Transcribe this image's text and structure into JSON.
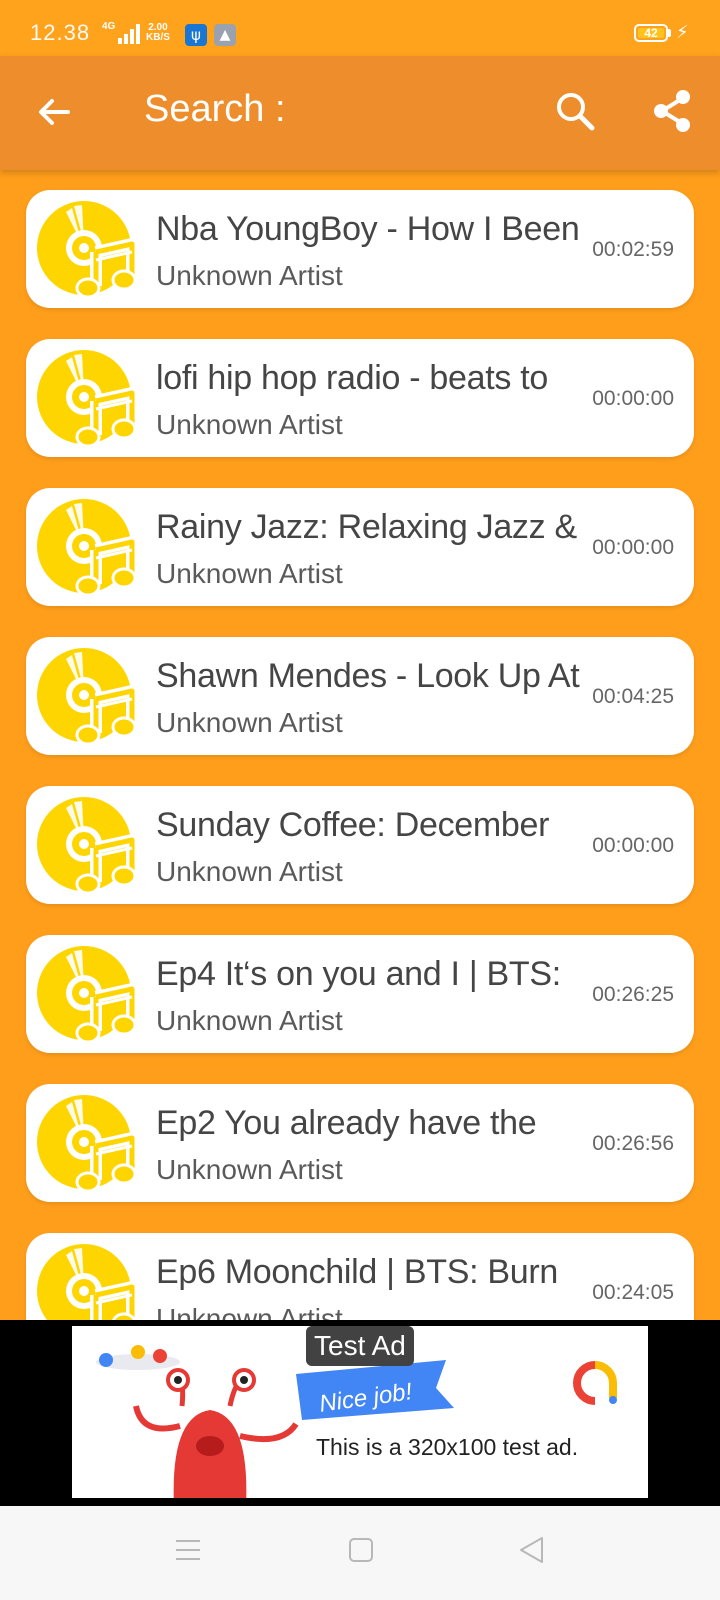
{
  "status_bar": {
    "time": "12.38",
    "network": "4G",
    "speed_value": "2.00",
    "speed_unit": "KB/S",
    "battery": "42"
  },
  "toolbar": {
    "title": "Search :",
    "back_icon": "arrow-left-icon",
    "search_icon": "search-icon",
    "share_icon": "share-icon"
  },
  "tracks": [
    {
      "title": "Nba YoungBoy - How I Been",
      "artist": "Unknown Artist",
      "duration": "00:02:59"
    },
    {
      "title": "lofi hip hop radio - beats to",
      "artist": "Unknown Artist",
      "duration": "00:00:00"
    },
    {
      "title": "Rainy Jazz: Relaxing Jazz &",
      "artist": "Unknown Artist",
      "duration": "00:00:00"
    },
    {
      "title": "Shawn Mendes - Look Up At",
      "artist": "Unknown Artist",
      "duration": "00:04:25"
    },
    {
      "title": "Sunday Coffee: December",
      "artist": "Unknown Artist",
      "duration": "00:00:00"
    },
    {
      "title": "Ep4 It‘s on you and I | BTS:",
      "artist": "Unknown Artist",
      "duration": "00:26:25"
    },
    {
      "title": "Ep2 You already have the",
      "artist": "Unknown Artist",
      "duration": "00:26:56"
    },
    {
      "title": "Ep6 Moonchild | BTS: Burn",
      "artist": "Unknown Artist",
      "duration": "00:24:05"
    }
  ],
  "ad": {
    "label": "Test Ad",
    "banner_text": "Nice job!",
    "body": "This is a 320x100 test ad."
  },
  "colors": {
    "background": "#ff9e1b",
    "toolbar": "#ee8d2b",
    "icon_yellow": "#ffd500"
  }
}
